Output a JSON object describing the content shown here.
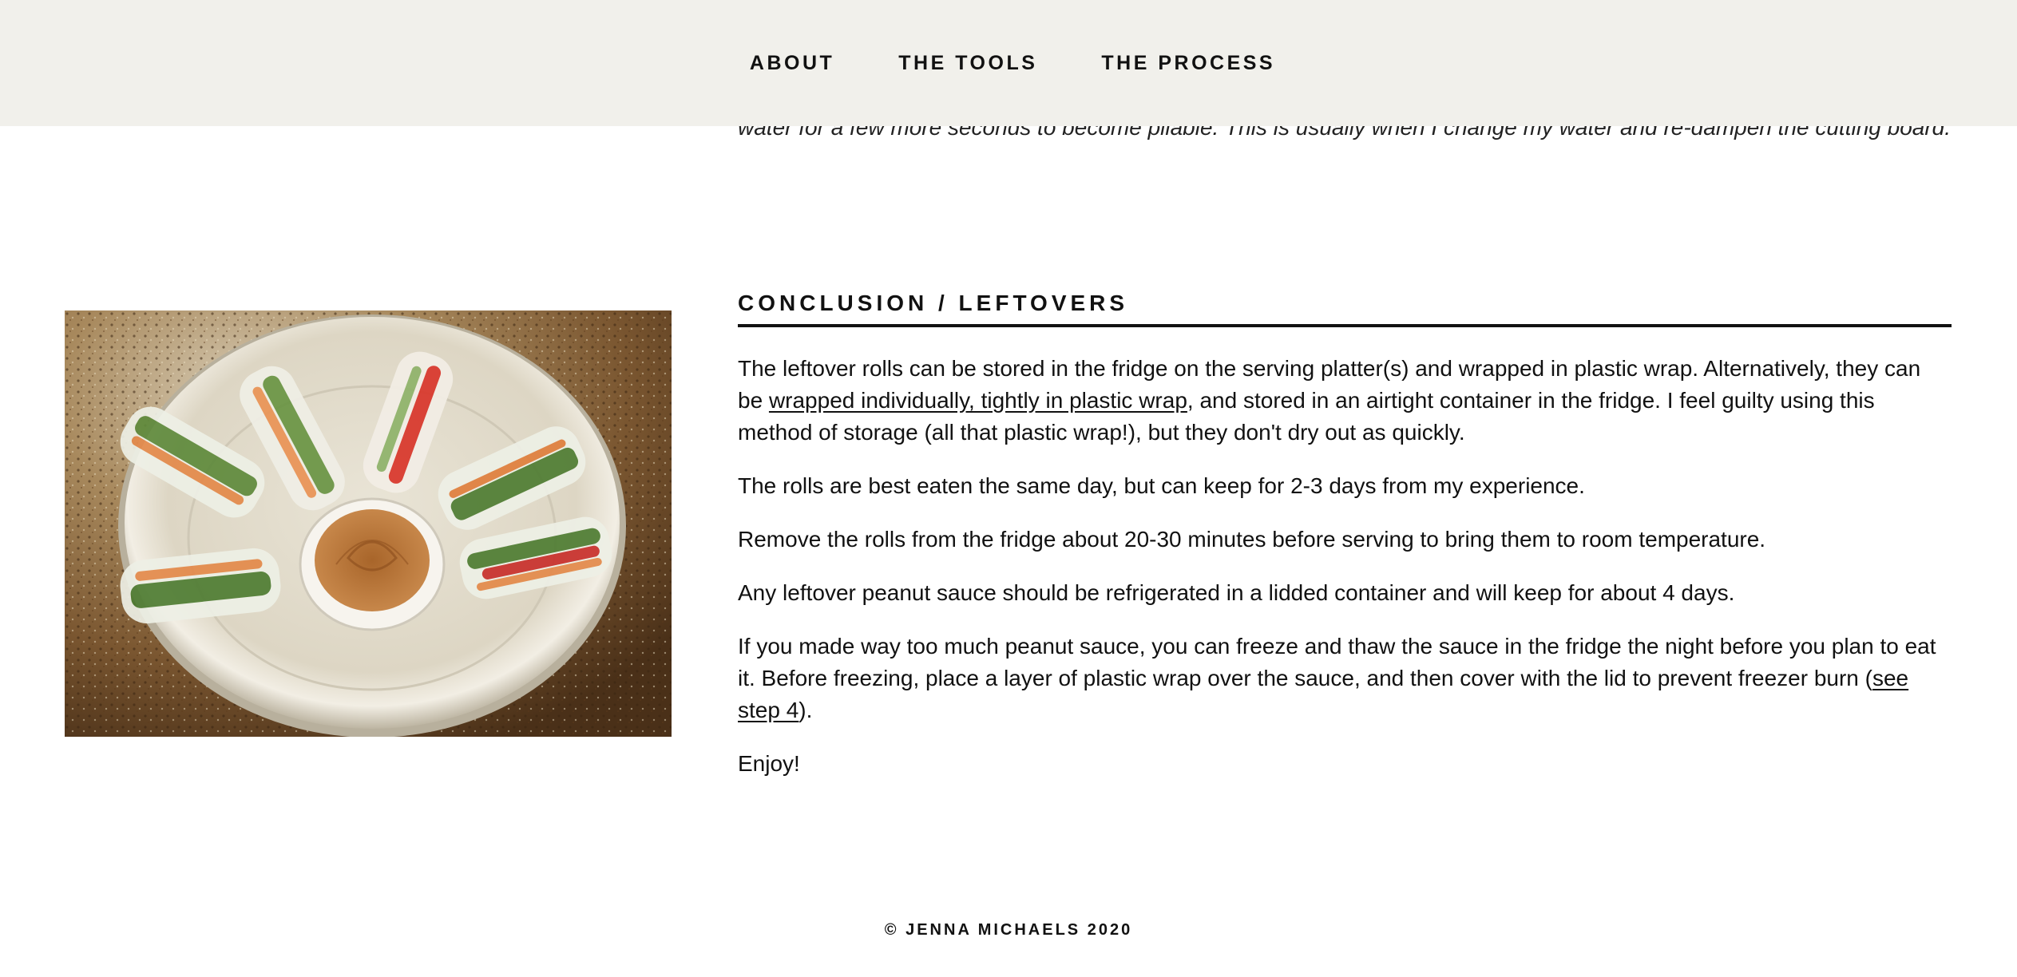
{
  "nav": {
    "items": [
      "ABOUT",
      "THE TOOLS",
      "THE PROCESS"
    ]
  },
  "clipped_text": "water for a few more seconds to become pliable. This is usually when I change my water and re-dampen the cutting board.",
  "section": {
    "heading": "CONCLUSION / LEFTOVERS",
    "p1_before": "The leftover rolls can be stored in the fridge on the serving platter(s) and wrapped in plastic wrap. Alternatively, they can be ",
    "p1_link": "wrapped individually, tightly in plastic wrap",
    "p1_after": ", and stored in an airtight container in the fridge. I feel guilty using this method of storage (all that plastic wrap!), but they don't dry out as quickly.",
    "p2": "The rolls are best eaten the same day, but can keep for 2-3 days from my experience.",
    "p3": "Remove the rolls from the fridge about 20-30 minutes before serving to bring them to room temperature.",
    "p4": "Any leftover peanut sauce should be refrigerated in a lidded container and will keep for about 4 days.",
    "p5_before": "If you made way too much peanut sauce, you can freeze and thaw the sauce in the fridge the night before you plan to eat it. Before freezing, place a layer of plastic wrap over the sauce, and then cover with the lid to prevent freezer burn (",
    "p5_link": "see step 4",
    "p5_after": ").",
    "p6": "Enjoy!"
  },
  "footer": "© JENNA MICHAELS 2020",
  "colors": {
    "header_bg": "#f1f0eb",
    "text": "#111111"
  }
}
